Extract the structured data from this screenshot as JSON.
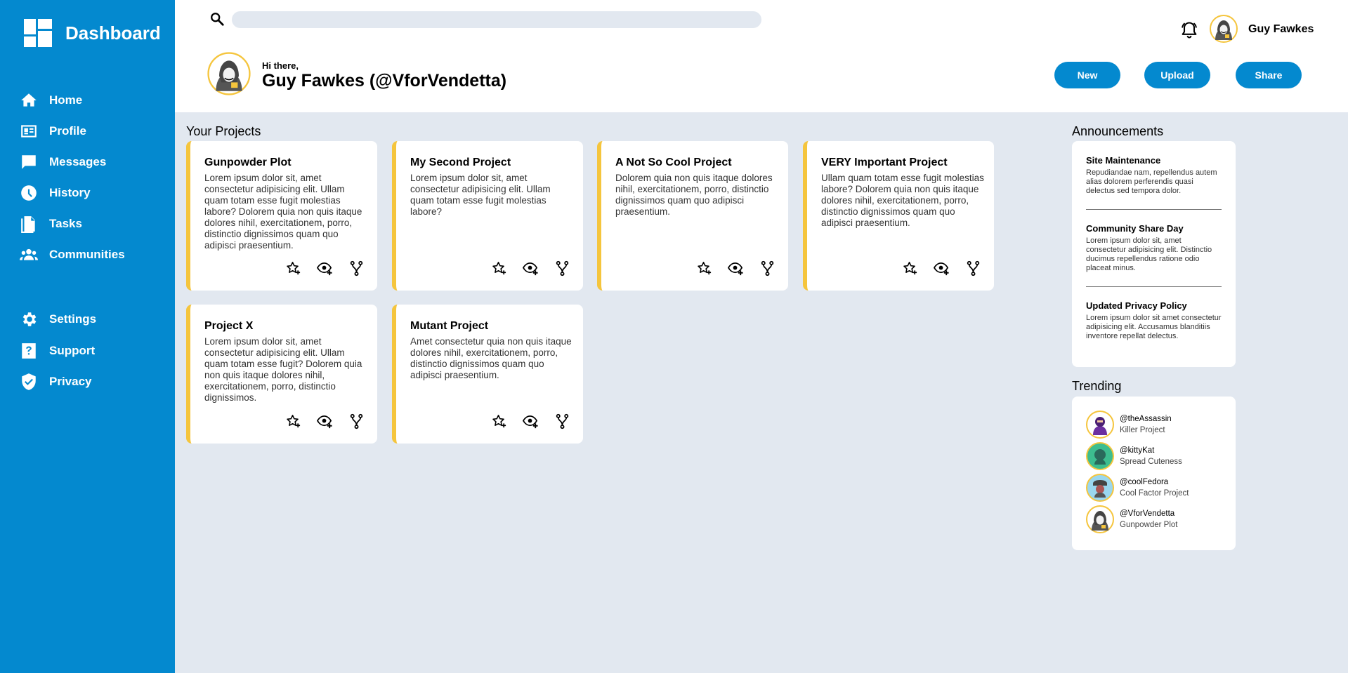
{
  "sidebar": {
    "brand": "Dashboard",
    "items": [
      {
        "label": "Home",
        "icon": "home-icon"
      },
      {
        "label": "Profile",
        "icon": "id-card-icon"
      },
      {
        "label": "Messages",
        "icon": "chat-icon"
      },
      {
        "label": "History",
        "icon": "clock-icon"
      },
      {
        "label": "Tasks",
        "icon": "document-icon"
      },
      {
        "label": "Communities",
        "icon": "users-icon"
      },
      {
        "label": "Settings",
        "icon": "gear-icon"
      },
      {
        "label": "Support",
        "icon": "help-icon"
      },
      {
        "label": "Privacy",
        "icon": "shield-icon"
      }
    ]
  },
  "header": {
    "search_placeholder": "",
    "user_name": "Guy Fawkes",
    "greeting": "Hi there,",
    "greeting_name": "Guy Fawkes (@VforVendetta)",
    "buttons": {
      "new": "New",
      "upload": "Upload",
      "share": "Share"
    }
  },
  "projects": {
    "title": "Your Projects",
    "items": [
      {
        "title": "Gunpowder Plot",
        "desc": "Lorem ipsum dolor sit, amet consectetur adipisicing elit. Ullam quam totam esse fugit molestias labore? Dolorem quia non quis itaque dolores nihil, exercitationem, porro, distinctio dignissimos quam quo adipisci praesentium."
      },
      {
        "title": "My Second Project",
        "desc": "Lorem ipsum dolor sit, amet consectetur adipisicing elit. Ullam quam totam esse fugit molestias labore?"
      },
      {
        "title": "A Not So Cool Project",
        "desc": "Dolorem quia non quis itaque dolores nihil, exercitationem, porro, distinctio dignissimos quam quo adipisci praesentium."
      },
      {
        "title": "VERY Important Project",
        "desc": "Ullam quam totam esse fugit molestias labore? Dolorem quia non quis itaque dolores nihil, exercitationem, porro, distinctio dignissimos quam quo adipisci praesentium."
      },
      {
        "title": "Project X",
        "desc": "Lorem ipsum dolor sit, amet consectetur adipisicing elit. Ullam quam totam esse fugit? Dolorem quia non quis itaque dolores nihil, exercitationem, porro, distinctio dignissimos."
      },
      {
        "title": "Mutant Project",
        "desc": "Amet consectetur quia non quis itaque dolores nihil, exercitationem, porro, distinctio dignissimos quam quo adipisci praesentium."
      }
    ]
  },
  "announcements": {
    "title": "Announcements",
    "items": [
      {
        "title": "Site Maintenance",
        "body": "Repudiandae nam, repellendus autem alias dolorem perferendis quasi delectus sed tempora dolor."
      },
      {
        "title": "Community Share Day",
        "body": "Lorem ipsum dolor sit, amet consectetur adipisicing elit. Distinctio ducimus repellendus ratione odio placeat minus."
      },
      {
        "title": "Updated Privacy Policy",
        "body": "Lorem ipsum dolor sit amet consectetur adipisicing elit. Accusamus blanditiis inventore repellat delectus."
      }
    ]
  },
  "trending": {
    "title": "Trending",
    "items": [
      {
        "handle": "@theAssassin",
        "project": "Killer Project"
      },
      {
        "handle": "@kittyKat",
        "project": "Spread Cuteness"
      },
      {
        "handle": "@coolFedora",
        "project": "Cool Factor Project"
      },
      {
        "handle": "@VforVendetta",
        "project": "Gunpowder Plot"
      }
    ]
  },
  "colors": {
    "primary": "#0489cf",
    "accent": "#f5c53d",
    "background": "#e2e8f0"
  }
}
